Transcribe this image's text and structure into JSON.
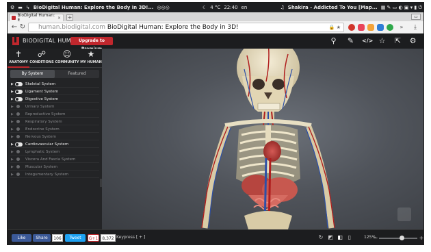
{
  "os_panel": {
    "app_title": "BioDigital Human: Explore the Body in 3D!...",
    "weather": "4 °C",
    "clock": "22:40",
    "lang": "en",
    "now_playing": "Shakira - Addicted To You [Map..."
  },
  "browser": {
    "tab_title": "BioDigital Human: E",
    "tab_close": "×",
    "new_tab": "+",
    "url_host": "human.biodigital.com",
    "url_title": "BioDigital Human: Explore the Body in 3D!",
    "more_label": "»"
  },
  "app": {
    "brand": "BIODIGITAL HUMAN",
    "upgrade_label": "Upgrade to Premium",
    "nav": [
      {
        "label": "ANATOMY",
        "glyph": "✝"
      },
      {
        "label": "CONDITIONS",
        "glyph": "☍"
      },
      {
        "label": "COMMUNITY",
        "glyph": "☺"
      },
      {
        "label": "MY HUMAN",
        "glyph": "★"
      }
    ],
    "segments": {
      "by_system": "By System",
      "featured": "Featured"
    },
    "systems": [
      {
        "name": "Skeletal System",
        "on": true
      },
      {
        "name": "Ligament System",
        "on": true
      },
      {
        "name": "Digestive System",
        "on": true
      },
      {
        "name": "Urinary System",
        "on": false
      },
      {
        "name": "Reproductive System",
        "on": false
      },
      {
        "name": "Respiratory System",
        "on": false
      },
      {
        "name": "Endocrine System",
        "on": false
      },
      {
        "name": "Nervous System",
        "on": false
      },
      {
        "name": "Cardiovascular System",
        "on": true
      },
      {
        "name": "Lymphatic System",
        "on": false
      },
      {
        "name": "Viscera And Fascia System",
        "on": false
      },
      {
        "name": "Muscular System",
        "on": false
      },
      {
        "name": "Integumentary System",
        "on": false
      }
    ]
  },
  "bottom": {
    "like": "Like",
    "share": "Share",
    "share_count": "106",
    "tweet": "Tweet",
    "gplus": "G+1",
    "gplus_count": "8,372",
    "keypress": "Keypress [ + ]",
    "zoom": "125%",
    "zoom_minus": "−",
    "zoom_plus": "+",
    "zoom_level_fraction": 0.6
  },
  "colors": {
    "accent": "#c0272d",
    "panel_bg": "#232426",
    "header_bg": "#1c1d1f",
    "facebook": "#3b5998",
    "twitter": "#1da1f2"
  }
}
